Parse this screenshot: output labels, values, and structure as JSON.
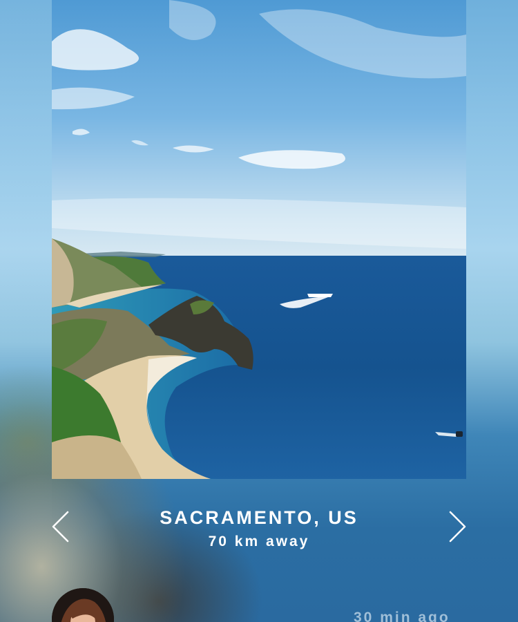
{
  "post": {
    "location_name": "SACRAMENTO, US",
    "distance": "70 km away",
    "timestamp": "30 min ago"
  },
  "navigation": {
    "prev_icon": "chevron-left-icon",
    "next_icon": "chevron-right-icon"
  },
  "colors": {
    "text_primary": "#ffffff",
    "timestamp": "#c8dceb",
    "sky": "#5fa6d8",
    "sea": "#1f5f9c"
  }
}
